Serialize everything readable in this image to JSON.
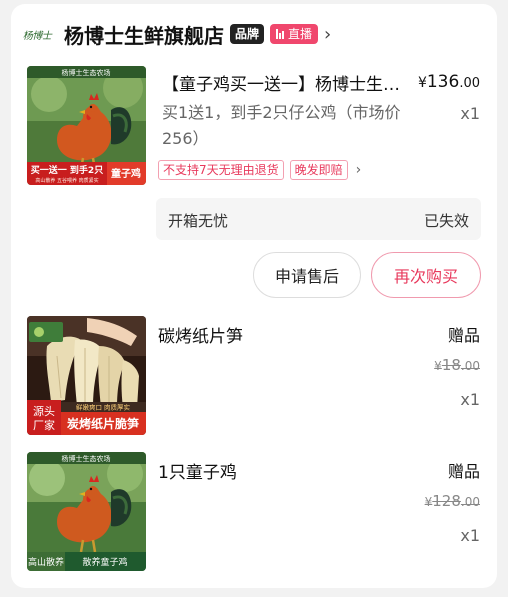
{
  "store": {
    "logo_text": "杨博士",
    "name": "杨博士生鲜旗舰店",
    "brand_badge": "品牌",
    "live_badge": "直播"
  },
  "main_item": {
    "title": "【童子鸡买一送一】杨博士生态农场散养童子鸡",
    "price_currency": "¥",
    "price_int": "136",
    "price_dec": ".00",
    "desc": "买1送1，到手2只仔公鸡（市场价256）",
    "qty": "x1",
    "tags": [
      "不支持7天无理由退货",
      "晚发即赔"
    ],
    "thumb_banner": "杨博士生态农场",
    "thumb_promo": "买一送一 到手2只",
    "thumb_promo_sub": "高山散养 五谷喂养 肉质紧实",
    "thumb_label": "童子鸡"
  },
  "service": {
    "name": "开箱无忧",
    "status": "已失效"
  },
  "actions": {
    "after_sale": "申请售后",
    "rebuy": "再次购买"
  },
  "gifts": [
    {
      "title": "碳烤纸片笋",
      "label": "赠品",
      "orig_currency": "¥",
      "orig_int": "18",
      "orig_dec": ".00",
      "qty": "x1",
      "thumb_corner": "源头厂家",
      "thumb_caption_top": "鲜嫩爽口 肉质厚实",
      "thumb_caption": "炭烤纸片脆笋"
    },
    {
      "title": "1只童子鸡",
      "label": "赠品",
      "orig_currency": "¥",
      "orig_int": "128",
      "orig_dec": ".00",
      "qty": "x1",
      "thumb_banner": "杨博士生态农场",
      "thumb_corner": "高山散养",
      "thumb_caption": "散养童子鸡"
    }
  ]
}
